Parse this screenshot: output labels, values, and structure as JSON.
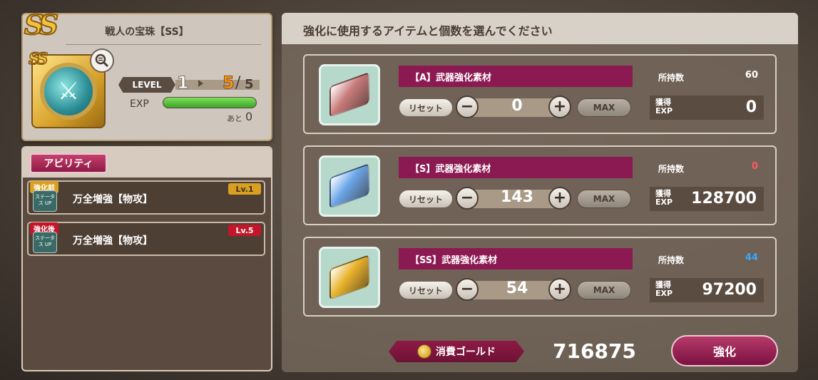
{
  "item": {
    "name": "戦人の宝珠【SS】",
    "rank": "SS",
    "level_label": "LEVEL",
    "level_current": "1",
    "level_next": "5",
    "level_slash": "/",
    "level_max": "5",
    "exp_label": "EXP",
    "exp_progress": 1.0,
    "exp_rest_label": "あと",
    "exp_rest_value": "0"
  },
  "abilities": {
    "tab_label": "アビリティ",
    "rows": [
      {
        "tag": "強化前",
        "tag_color": "#d9a020",
        "icon_text": "ステータス UP",
        "name": "万全増強【物攻】",
        "level": "Lv.1",
        "level_bg": "#d9a020",
        "level_color": "#3a2e26"
      },
      {
        "tag": "強化後",
        "tag_color": "#c4162a",
        "icon_text": "ステータス UP",
        "name": "万全増強【物攻】",
        "level": "Lv.5",
        "level_bg": "#c4162a",
        "level_color": "#ffffff"
      }
    ]
  },
  "main": {
    "title": "強化に使用するアイテムと個数を選んでください",
    "reset_label": "リセット",
    "max_label": "MAX",
    "owned_label": "所持数",
    "exp_box_label": "獲得\nEXP",
    "minus_icon": "−",
    "plus_icon": "+",
    "materials": [
      {
        "name": "【A】武器強化素材",
        "owned": "60",
        "owned_color": "#ffffff",
        "quantity": "0",
        "exp": "0",
        "icon_color": "#c97b7b"
      },
      {
        "name": "【S】武器強化素材",
        "owned": "0",
        "owned_color": "#ff5a5a",
        "quantity": "143",
        "exp": "128700",
        "icon_color": "#6aa6e8"
      },
      {
        "name": "【SS】武器強化素材",
        "owned": "44",
        "owned_color": "#3aa8ff",
        "quantity": "54",
        "exp": "97200",
        "icon_color": "#e8b22a"
      }
    ]
  },
  "footer": {
    "gold_label": "消費ゴールド",
    "gold_value": "716875",
    "enhance_label": "強化"
  }
}
